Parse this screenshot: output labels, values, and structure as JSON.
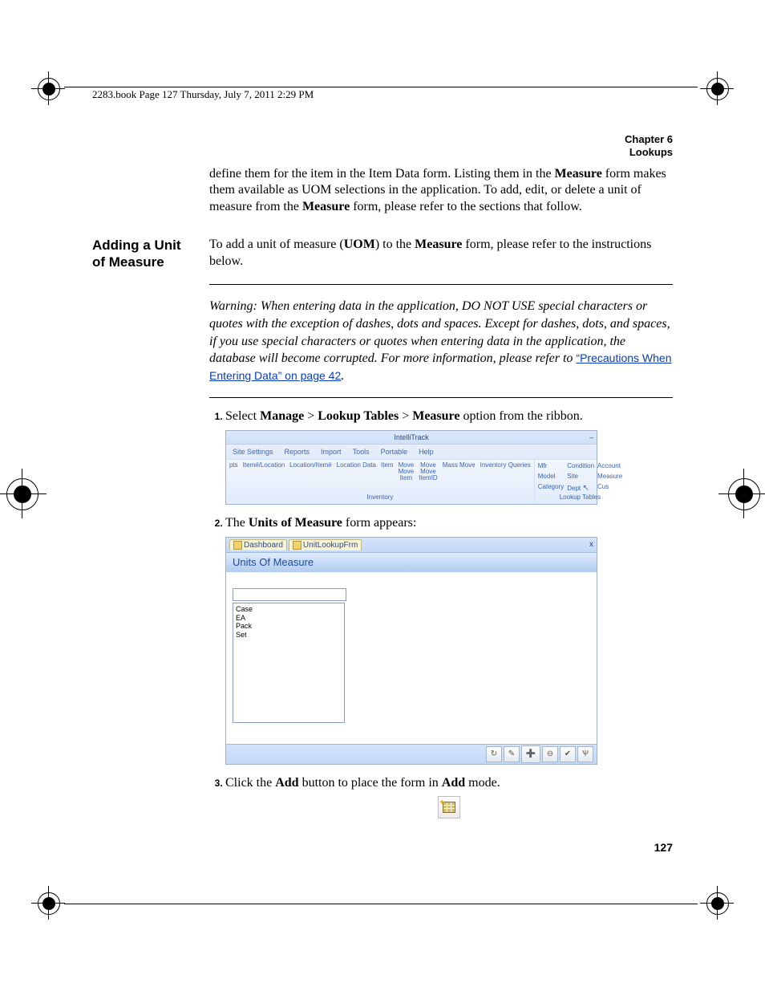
{
  "header": {
    "line": "2283.book  Page 127  Thursday, July 7, 2011  2:29 PM"
  },
  "chapter": {
    "label": "Chapter 6",
    "title": "Lookups"
  },
  "intro_paragraph": {
    "pre": "define them for the item in the Item Data form. Listing them in the ",
    "b1": "Measure",
    "mid": " form makes them available as UOM selections in the application. To add, edit, or delete a unit of measure from the ",
    "b2": "Measure",
    "post": " form, please refer to the sections that follow."
  },
  "section": {
    "heading1": "Adding a Unit",
    "heading2": "of Measure",
    "lede_pre": "To add a unit of measure (",
    "lede_b1": "UOM",
    "lede_mid1": ") to the ",
    "lede_b2": "Measure",
    "lede_post": " form, please refer to the instructions below."
  },
  "warning": {
    "label": "Warning:  ",
    "text": "When entering data in the application, DO NOT USE special characters or quotes with the exception of dashes, dots and spaces. Except for dashes, dots, and spaces, if you use special characters or quotes when entering data in the application, the database will become corrupted. For more information, please refer to ",
    "link": "“Precautions When Entering Data” on page 42",
    "period": "."
  },
  "steps": {
    "s1": {
      "pre": "Select ",
      "b1": "Manage",
      "gt1": " > ",
      "b2": "Lookup Tables",
      "gt2": " > ",
      "b3": "Measure",
      "post": " option from the ribbon."
    },
    "s2": {
      "pre": "The ",
      "b1": "Units of Measure",
      "post": " form appears:"
    },
    "s3": {
      "pre": "Click the ",
      "b1": "Add",
      "mid": " button to place the form in ",
      "b2": "Add",
      "post": " mode."
    }
  },
  "ribbon": {
    "app_title": "IntelliTrack",
    "min": "–",
    "tabs": {
      "site": "Site Settings",
      "reports": "Reports",
      "import": "Import",
      "tools": "Tools",
      "portable": "Portable",
      "help": "Help"
    },
    "inventory": {
      "pts": "pts",
      "itemloc": "Item#/Location",
      "locitem": "Location/Item#",
      "locdata": "Location Data",
      "item": "Item",
      "move_move_item": "Move Move Item",
      "move_itemid": "Move Move ItemID",
      "mass_move": "Mass Move",
      "queries": "Inventory Queries",
      "group": "Inventory"
    },
    "lookup": {
      "mfr": "Mfr",
      "condition": "Condition",
      "account": "Account",
      "model": "Model",
      "site": "Site",
      "measure": "Measure",
      "category": "Category",
      "dept": "Dept",
      "cus": "Cus",
      "group": "Lookup Tables"
    }
  },
  "uom_form": {
    "tabs": {
      "dash": "Dashboard",
      "lookup": "UnitLookupFrm"
    },
    "close": "x",
    "title": "Units Of Measure",
    "items": [
      "Case",
      "EA",
      "Pack",
      "Set"
    ],
    "buttons": {
      "a": "↻",
      "b": "✎",
      "c": "➕",
      "d": "⊖",
      "e": "✔",
      "f": "Ѱ"
    }
  },
  "page_number": "127"
}
